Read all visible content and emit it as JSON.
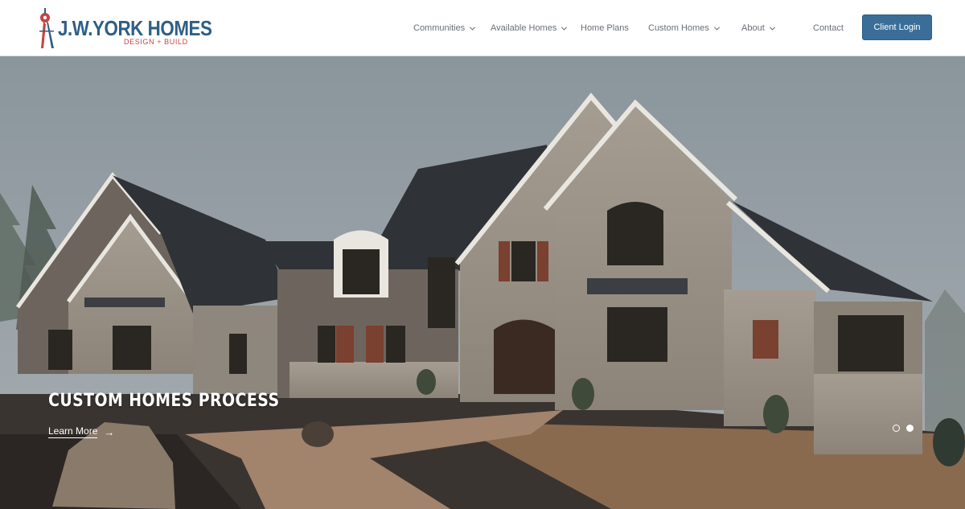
{
  "brand": {
    "name": "J.W.YORK HOMES",
    "tagline": "DESIGN + BUILD",
    "colors": {
      "primary": "#2e5f86",
      "accent": "#c8433f"
    }
  },
  "nav": {
    "items": [
      {
        "label": "Communities",
        "has_dropdown": true
      },
      {
        "label": "Available Homes",
        "has_dropdown": true
      },
      {
        "label": "Home Plans",
        "has_dropdown": false
      },
      {
        "label": "Custom Homes",
        "has_dropdown": true
      },
      {
        "label": "About",
        "has_dropdown": true
      },
      {
        "label": "Contact",
        "has_dropdown": false
      }
    ],
    "login_label": "Client Login",
    "login_color": "#3a6e98"
  },
  "hero": {
    "title": "CUSTOM HOMES PROCESS",
    "cta_label": "Learn More",
    "cta_icon": "arrow-right-icon",
    "slides": 2,
    "active_slide": 2
  }
}
